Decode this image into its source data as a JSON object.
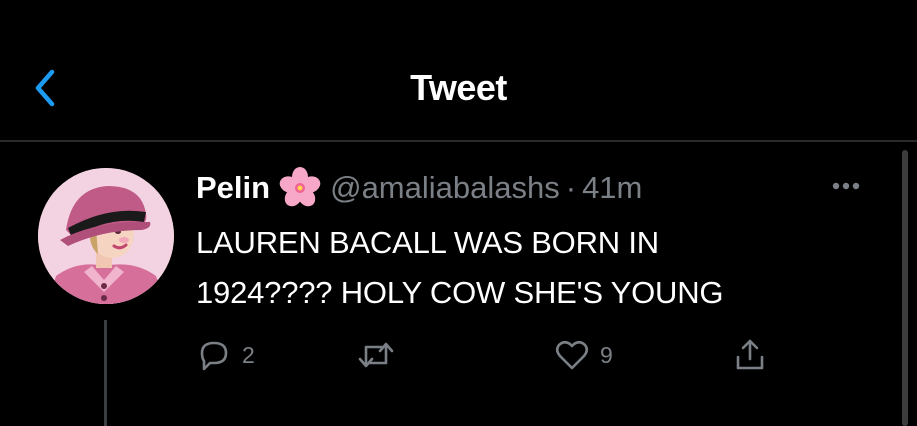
{
  "header": {
    "title": "Tweet",
    "back_icon": "chevron-left-icon",
    "accent_color": "#1d9bf0"
  },
  "tweet": {
    "author_name": "Pelin",
    "name_emoji": "cherry-blossom-icon",
    "handle": "@amaliabalashs",
    "separator": "·",
    "time": "41m",
    "text_line1": "LAUREN BACALL WAS BORN IN",
    "text_line2": "1924???? HOLY COW SHE'S YOUNG",
    "replies": "2",
    "retweets": "",
    "likes": "9",
    "more_icon": "more-horizontal-icon"
  },
  "colors": {
    "background": "#000000",
    "text": "#ffffff",
    "secondary_text": "#7a8086",
    "divider": "#2a2a2a"
  }
}
